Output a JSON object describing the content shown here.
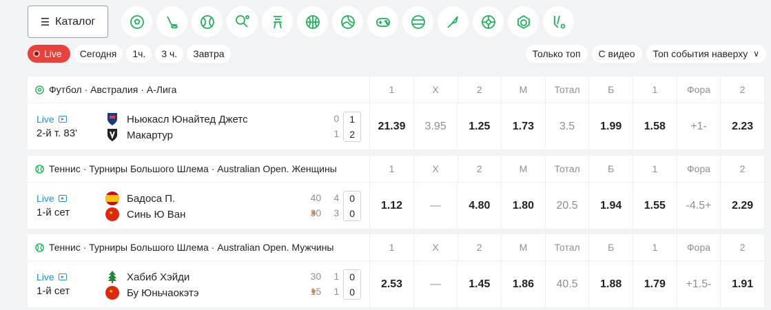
{
  "header": {
    "catalog_label": "Каталог",
    "sports": [
      {
        "name": "football"
      },
      {
        "name": "ice-hockey"
      },
      {
        "name": "tennis"
      },
      {
        "name": "table-tennis"
      },
      {
        "name": "esports-tower"
      },
      {
        "name": "basketball"
      },
      {
        "name": "volleyball"
      },
      {
        "name": "gamepad"
      },
      {
        "name": "baseball"
      },
      {
        "name": "badminton"
      },
      {
        "name": "futsal"
      },
      {
        "name": "handball"
      },
      {
        "name": "floorball"
      }
    ]
  },
  "filters": {
    "live": "Live",
    "today": "Сегодня",
    "h1": "1ч.",
    "h3": "3 ч.",
    "tomorrow": "Завтра",
    "only_top": "Только топ",
    "with_video": "С видео",
    "sort": "Топ события наверху"
  },
  "columns": [
    "1",
    "X",
    "2",
    "М",
    "Тотал",
    "Б",
    "1",
    "Фора",
    "2"
  ],
  "events": [
    {
      "league": "Футбол · Австралия · А-Лига",
      "live": "Live",
      "period": "2-й т. 83'",
      "team1": "Ньюкасл Юнайтед Джетс",
      "team2": "Макартур",
      "score_extra1": [
        "0"
      ],
      "score_extra2": [
        "1"
      ],
      "score_main1": "1",
      "score_main2": "2",
      "odds": [
        "21.39",
        "3.95",
        "1.25",
        "1.73",
        "3.5",
        "1.99",
        "1.58",
        "+1-",
        "2.23"
      ]
    },
    {
      "league": "Теннис · Турниры Большого Шлема · Australian Open. Женщины",
      "live": "Live",
      "period": "1-й сет",
      "team1": "Бадоса П.",
      "team2": "Синь Ю Ван",
      "score_extra1": [
        "40",
        "4"
      ],
      "score_extra2": [
        "30",
        "3"
      ],
      "score_main1": "0",
      "score_main2": "0",
      "odds": [
        "1.12",
        "—",
        "4.80",
        "1.80",
        "20.5",
        "1.94",
        "1.55",
        "-4.5+",
        "2.29"
      ]
    },
    {
      "league": "Теннис · Турниры Большого Шлема · Australian Open. Мужчины",
      "live": "Live",
      "period": "1-й сет",
      "team1": "Хабиб Хэйди",
      "team2": "Бу Юньчаокэтэ",
      "score_extra1": [
        "30",
        "1"
      ],
      "score_extra2": [
        "15",
        "1"
      ],
      "score_main1": "0",
      "score_main2": "0",
      "odds": [
        "2.53",
        "—",
        "1.45",
        "1.86",
        "40.5",
        "1.88",
        "1.79",
        "+1.5-",
        "1.91"
      ]
    }
  ],
  "colors": {
    "accent": "#1fb25a",
    "live": "#e8423d",
    "link": "#1f8fd6"
  }
}
